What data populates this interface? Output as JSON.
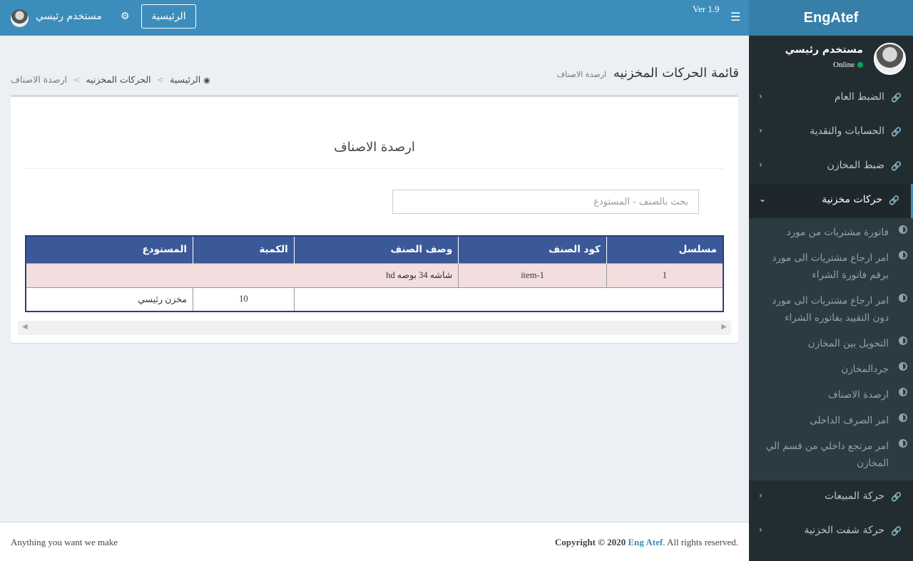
{
  "brand": "EngAtef",
  "header": {
    "version": "Ver 1.9",
    "home_button": "الرئيسية",
    "user_name": "مستخدم رئيسي"
  },
  "sidebar": {
    "user_name": "مستخدم رئيسي",
    "status": "Online",
    "items": [
      {
        "label": "الضبط العام"
      },
      {
        "label": "الحسابات والنقدية"
      },
      {
        "label": "ضبط المخازن"
      },
      {
        "label": "حركات مخزنية"
      },
      {
        "label": "حركة المبيعات"
      },
      {
        "label": "حركة شفت الخزنية"
      }
    ],
    "subitems": [
      "فاتورة مشتريات من مورد",
      "امر ارجاع مشتريات الى مورد برقم فاتورة الشراء",
      "امر ارجاع مشتريات الى مورد دون التقييد بفاتوره الشراء",
      "التحويل بين المخازن",
      "جردالمخازن",
      "ارصدة الاصناف",
      "امر الصرف الداخلى",
      "امر مرتجع داخلي من قسم الي المخازن"
    ]
  },
  "content": {
    "page_title": "قائمة الحركات المخزنيه",
    "page_subtitle": "ارصدة الاصناف",
    "breadcrumb": [
      "الرئيسية",
      "الحركات المخزنيه",
      "ارصدة الاصناف"
    ],
    "box_title": "ارصدة الاصناف",
    "search_placeholder": "بحث بالصنف - المستودع",
    "columns": [
      "مسلسل",
      "كود الصنف",
      "وصف الصنف",
      "الكمية",
      "المستودع"
    ],
    "item_row": {
      "serial": "1",
      "code": "item-1",
      "description": "شاشه 34 بوصه hd"
    },
    "stock_row": {
      "quantity": "10",
      "warehouse": "مخزن رئيسي"
    }
  },
  "footer": {
    "copyright_prefix": "Copyright © 2020",
    "author": "Eng Atef",
    "copyright_suffix": ". All rights reserved.",
    "slogan": "Anything you want we make"
  },
  "colors": {
    "header": "#3c8dbc",
    "logo": "#367fa9",
    "sidebar": "#222d32",
    "table_header": "#3b5998",
    "item_row": "#f2dede"
  }
}
